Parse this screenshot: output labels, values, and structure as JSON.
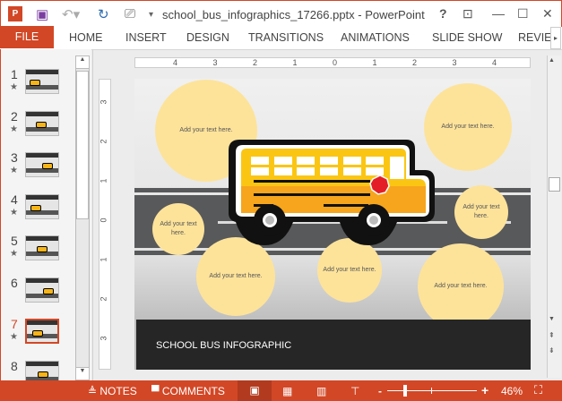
{
  "window": {
    "title": "school_bus_infographics_17266.pptx - PowerPoint",
    "help": "?",
    "ribbon_display": "⊡",
    "minimize": "—",
    "maximize": "☐",
    "close": "✕"
  },
  "quick_access": {
    "app_icon": "powerpoint-icon",
    "save": "save-icon",
    "undo": "undo-icon",
    "redo": "redo-icon",
    "start": "presentation-icon",
    "customize": "▾"
  },
  "ribbon": {
    "file": "FILE",
    "tabs": [
      "HOME",
      "INSERT",
      "DESIGN",
      "TRANSITIONS",
      "ANIMATIONS",
      "SLIDE SHOW",
      "REVIEW"
    ]
  },
  "slides": [
    {
      "n": "1",
      "star": true
    },
    {
      "n": "2",
      "star": true
    },
    {
      "n": "3",
      "star": true
    },
    {
      "n": "4",
      "star": true
    },
    {
      "n": "5",
      "star": true
    },
    {
      "n": "6",
      "star": false
    },
    {
      "n": "7",
      "star": true,
      "selected": true
    },
    {
      "n": "8",
      "star": false
    }
  ],
  "ruler": {
    "h": [
      "4",
      "3",
      "2",
      "1",
      "0",
      "1",
      "2",
      "3",
      "4"
    ],
    "v": [
      "3",
      "2",
      "1",
      "0",
      "1",
      "2",
      "3"
    ]
  },
  "slide": {
    "title": "SCHOOL BUS INFOGRAPHIC",
    "placeholders": [
      "Add your text here.",
      "Add your text here.",
      "Add your text here.",
      "Add your text here.",
      "Add your text here.",
      "Add your text here.",
      "Add your text here."
    ]
  },
  "status": {
    "notes": "NOTES",
    "comments": "COMMENTS",
    "zoom": "46%",
    "zoom_level": 46
  },
  "colors": {
    "accent": "#d24726",
    "bus": "#f6b417",
    "circle": "#fde39a",
    "road": "#58595b",
    "footer": "#262626"
  }
}
